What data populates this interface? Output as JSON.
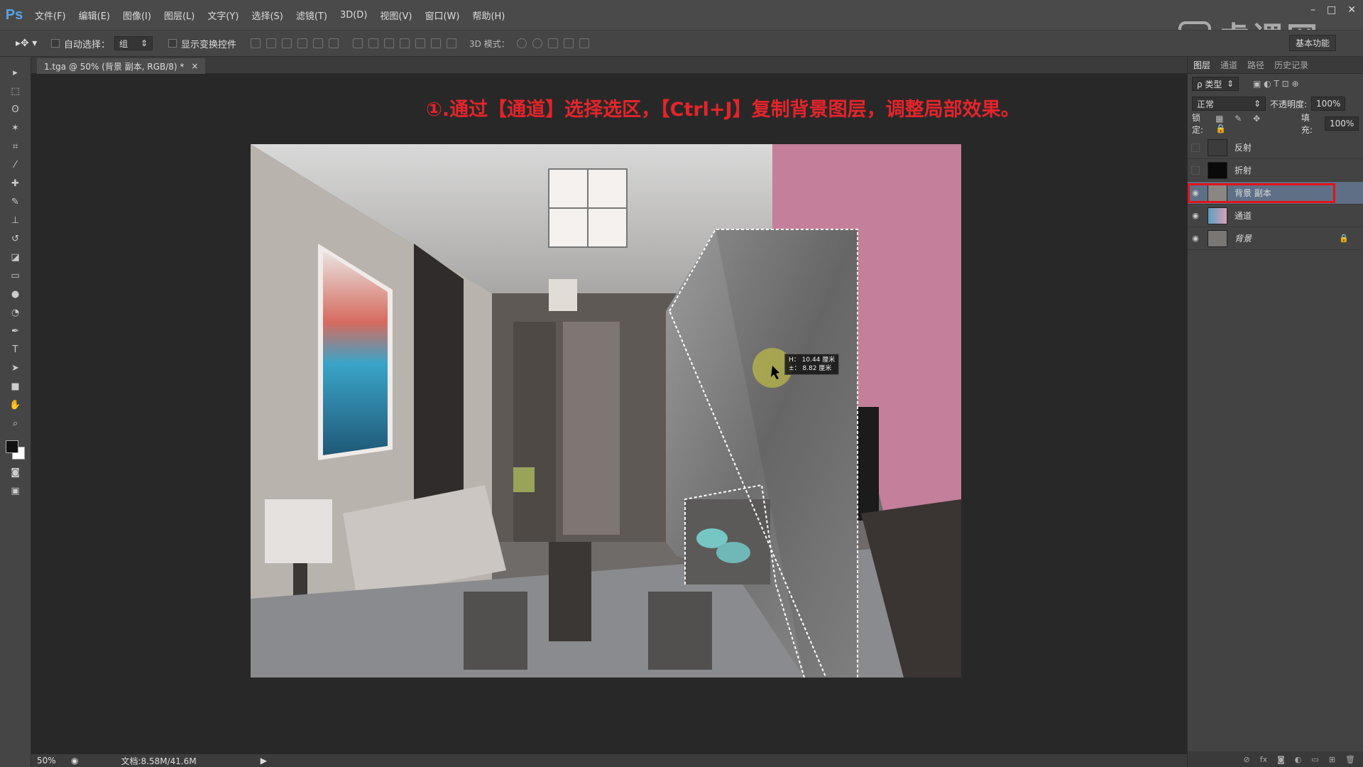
{
  "app": {
    "logo": "Ps"
  },
  "menu": [
    "文件(F)",
    "编辑(E)",
    "图像(I)",
    "图层(L)",
    "文字(Y)",
    "选择(S)",
    "滤镜(T)",
    "3D(D)",
    "视图(V)",
    "窗口(W)",
    "帮助(H)"
  ],
  "watermark": "虎课网",
  "window_controls": {
    "minimize": "–",
    "maximize": "□",
    "close": "✕"
  },
  "options": {
    "auto_select_label": "自动选择：",
    "auto_select_value": "组",
    "show_transform_label": "显示变换控件",
    "mode_3d_label": "3D 模式：",
    "workspace": "基本功能"
  },
  "document": {
    "tab_title": "1.tga @ 50% (背景 副本, RGB/8) *",
    "tab_close": "×"
  },
  "instruction": "①.通过【通道】选择选区，【Ctrl+J】复制背景图层，调整局部效果。",
  "measure": {
    "line1": "H： 10.44 厘米",
    "line2": "±： 8.82 厘米"
  },
  "status": {
    "zoom": "50%",
    "doc_info": "文档:8.58M/41.6M"
  },
  "panel": {
    "tabs": [
      "图层",
      "通道",
      "路径",
      "历史记录"
    ],
    "filter_label": "ρ 类型",
    "blend_mode": "正常",
    "opacity_label": "不透明度:",
    "opacity_value": "100%",
    "lock_label": "锁定:",
    "fill_label": "填充:",
    "fill_value": "100%"
  },
  "layers": [
    {
      "name": "反射",
      "visible": false,
      "selected": false
    },
    {
      "name": "折射",
      "visible": false,
      "selected": false
    },
    {
      "name": "背景 副本",
      "visible": true,
      "selected": true
    },
    {
      "name": "通道",
      "visible": true,
      "selected": false
    },
    {
      "name": "背景",
      "visible": true,
      "selected": false,
      "locked": true
    }
  ],
  "colors": {
    "accent_red": "#e3131a",
    "pink_wall": "#c47f9a",
    "ps_blue": "#5aa3e6"
  }
}
